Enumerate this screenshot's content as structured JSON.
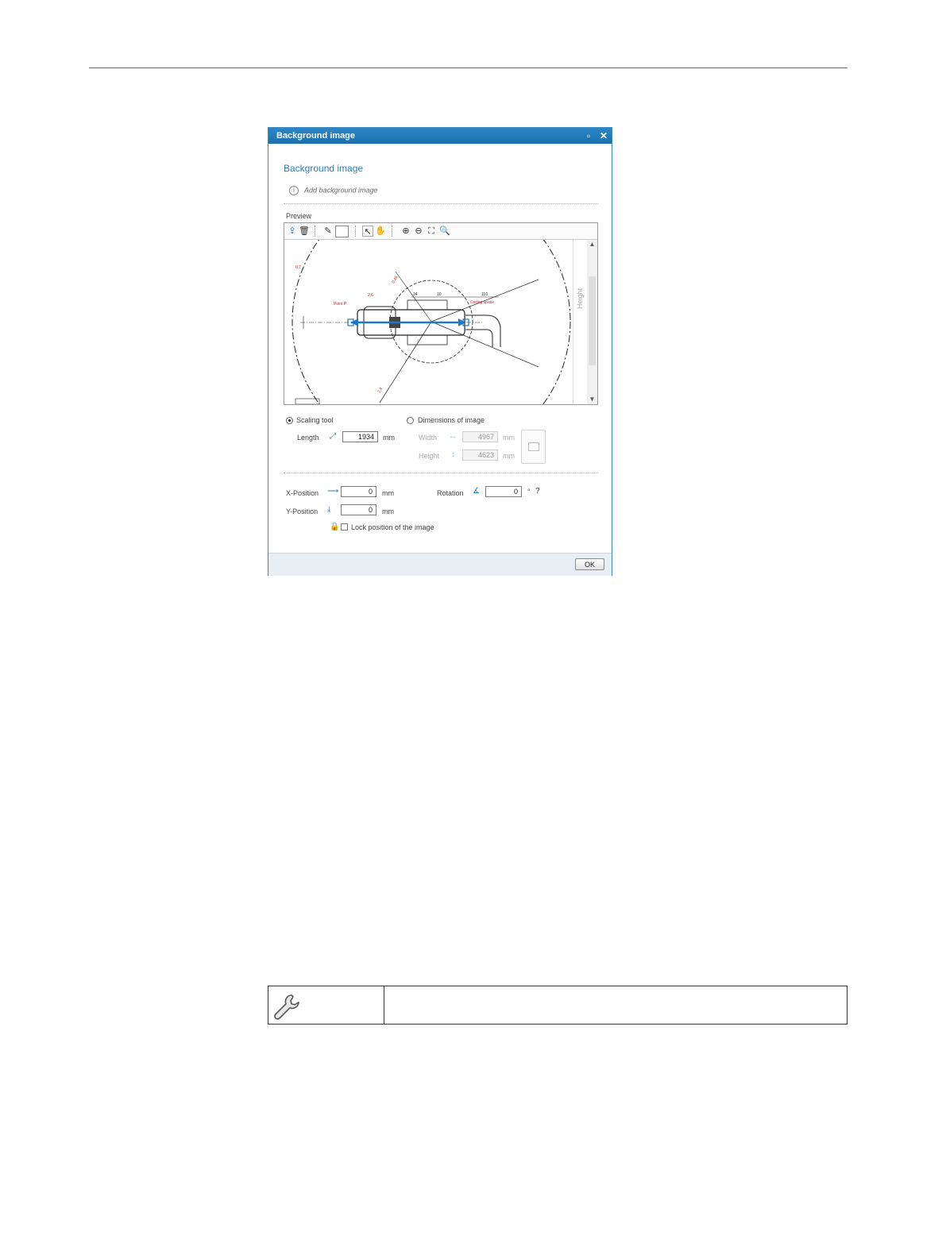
{
  "dialog": {
    "title": "Background image",
    "heading": "Background image",
    "info_text": "Add background image",
    "info_icon": "i",
    "preview_label": "Preview",
    "canvas": {
      "height_label": "Height",
      "drawing_labels": [
        "0,7",
        "Point P",
        "2,6",
        "0,46",
        "24",
        "10",
        "110",
        "Ceiling space",
        "2,4"
      ]
    },
    "scaling": {
      "option_label": "Scaling tool",
      "selected": true,
      "length_label": "Length",
      "length_value": "1934",
      "length_unit": "mm"
    },
    "dimensions": {
      "option_label": "Dimensions of image",
      "selected": false,
      "width_label": "Width",
      "width_value": "4967",
      "width_unit": "mm",
      "height_label": "Height",
      "height_value": "4623",
      "height_unit": "mm"
    },
    "position": {
      "x_label": "X-Position",
      "x_value": "0",
      "x_unit": "mm",
      "y_label": "Y-Position",
      "y_value": "0",
      "y_unit": "mm",
      "rotation_label": "Rotation",
      "rotation_value": "0",
      "rotation_unit": "°",
      "lock_label": "Lock position of the image"
    },
    "ok_label": "OK"
  },
  "colors": {
    "accent": "#2e7db8",
    "titlebar": "#1f73b3",
    "rule": "#0a7bbf",
    "drawing_red": "#cc2222"
  }
}
